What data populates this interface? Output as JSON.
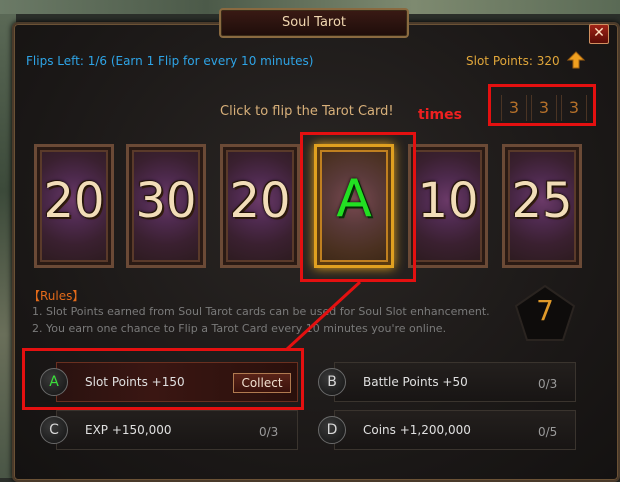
{
  "window": {
    "title": "Soul Tarot",
    "close_glyph": "✕"
  },
  "header": {
    "flips_left": "Flips Left: 1/6 (Earn 1 Flip for every 10 minutes)",
    "slot_points": "Slot Points: 320"
  },
  "hint": "Click to flip the Tarot Card!",
  "annotation": {
    "times": "times"
  },
  "counter_digits": [
    "3",
    "3",
    "3"
  ],
  "cards": [
    {
      "value": "20",
      "selected": false
    },
    {
      "value": "30",
      "selected": false
    },
    {
      "value": "20",
      "selected": false
    },
    {
      "value": "A",
      "selected": true
    },
    {
      "value": "10",
      "selected": false
    },
    {
      "value": "25",
      "selected": false
    }
  ],
  "rules": {
    "title": "【Rules】",
    "items": [
      "1. Slot Points earned from Soul Tarot cards can be used for Soul Slot enhancement.",
      "2. You earn one chance to Flip a Tarot Card every 10 minutes you're online."
    ]
  },
  "pentagon_value": "7",
  "rewards": [
    {
      "letter": "A",
      "label": "Slot Points +150",
      "action": "Collect",
      "count": ""
    },
    {
      "letter": "B",
      "label": "Battle Points +50",
      "count": "0/3"
    },
    {
      "letter": "C",
      "label": "EXP +150,000",
      "count": "0/3"
    },
    {
      "letter": "D",
      "label": "Coins +1,200,000",
      "count": "0/5"
    }
  ],
  "colors": {
    "accent_red": "#e41010",
    "flips_blue": "#2ea4e6",
    "gold": "#e0a63a",
    "selected_green": "#22e022"
  }
}
